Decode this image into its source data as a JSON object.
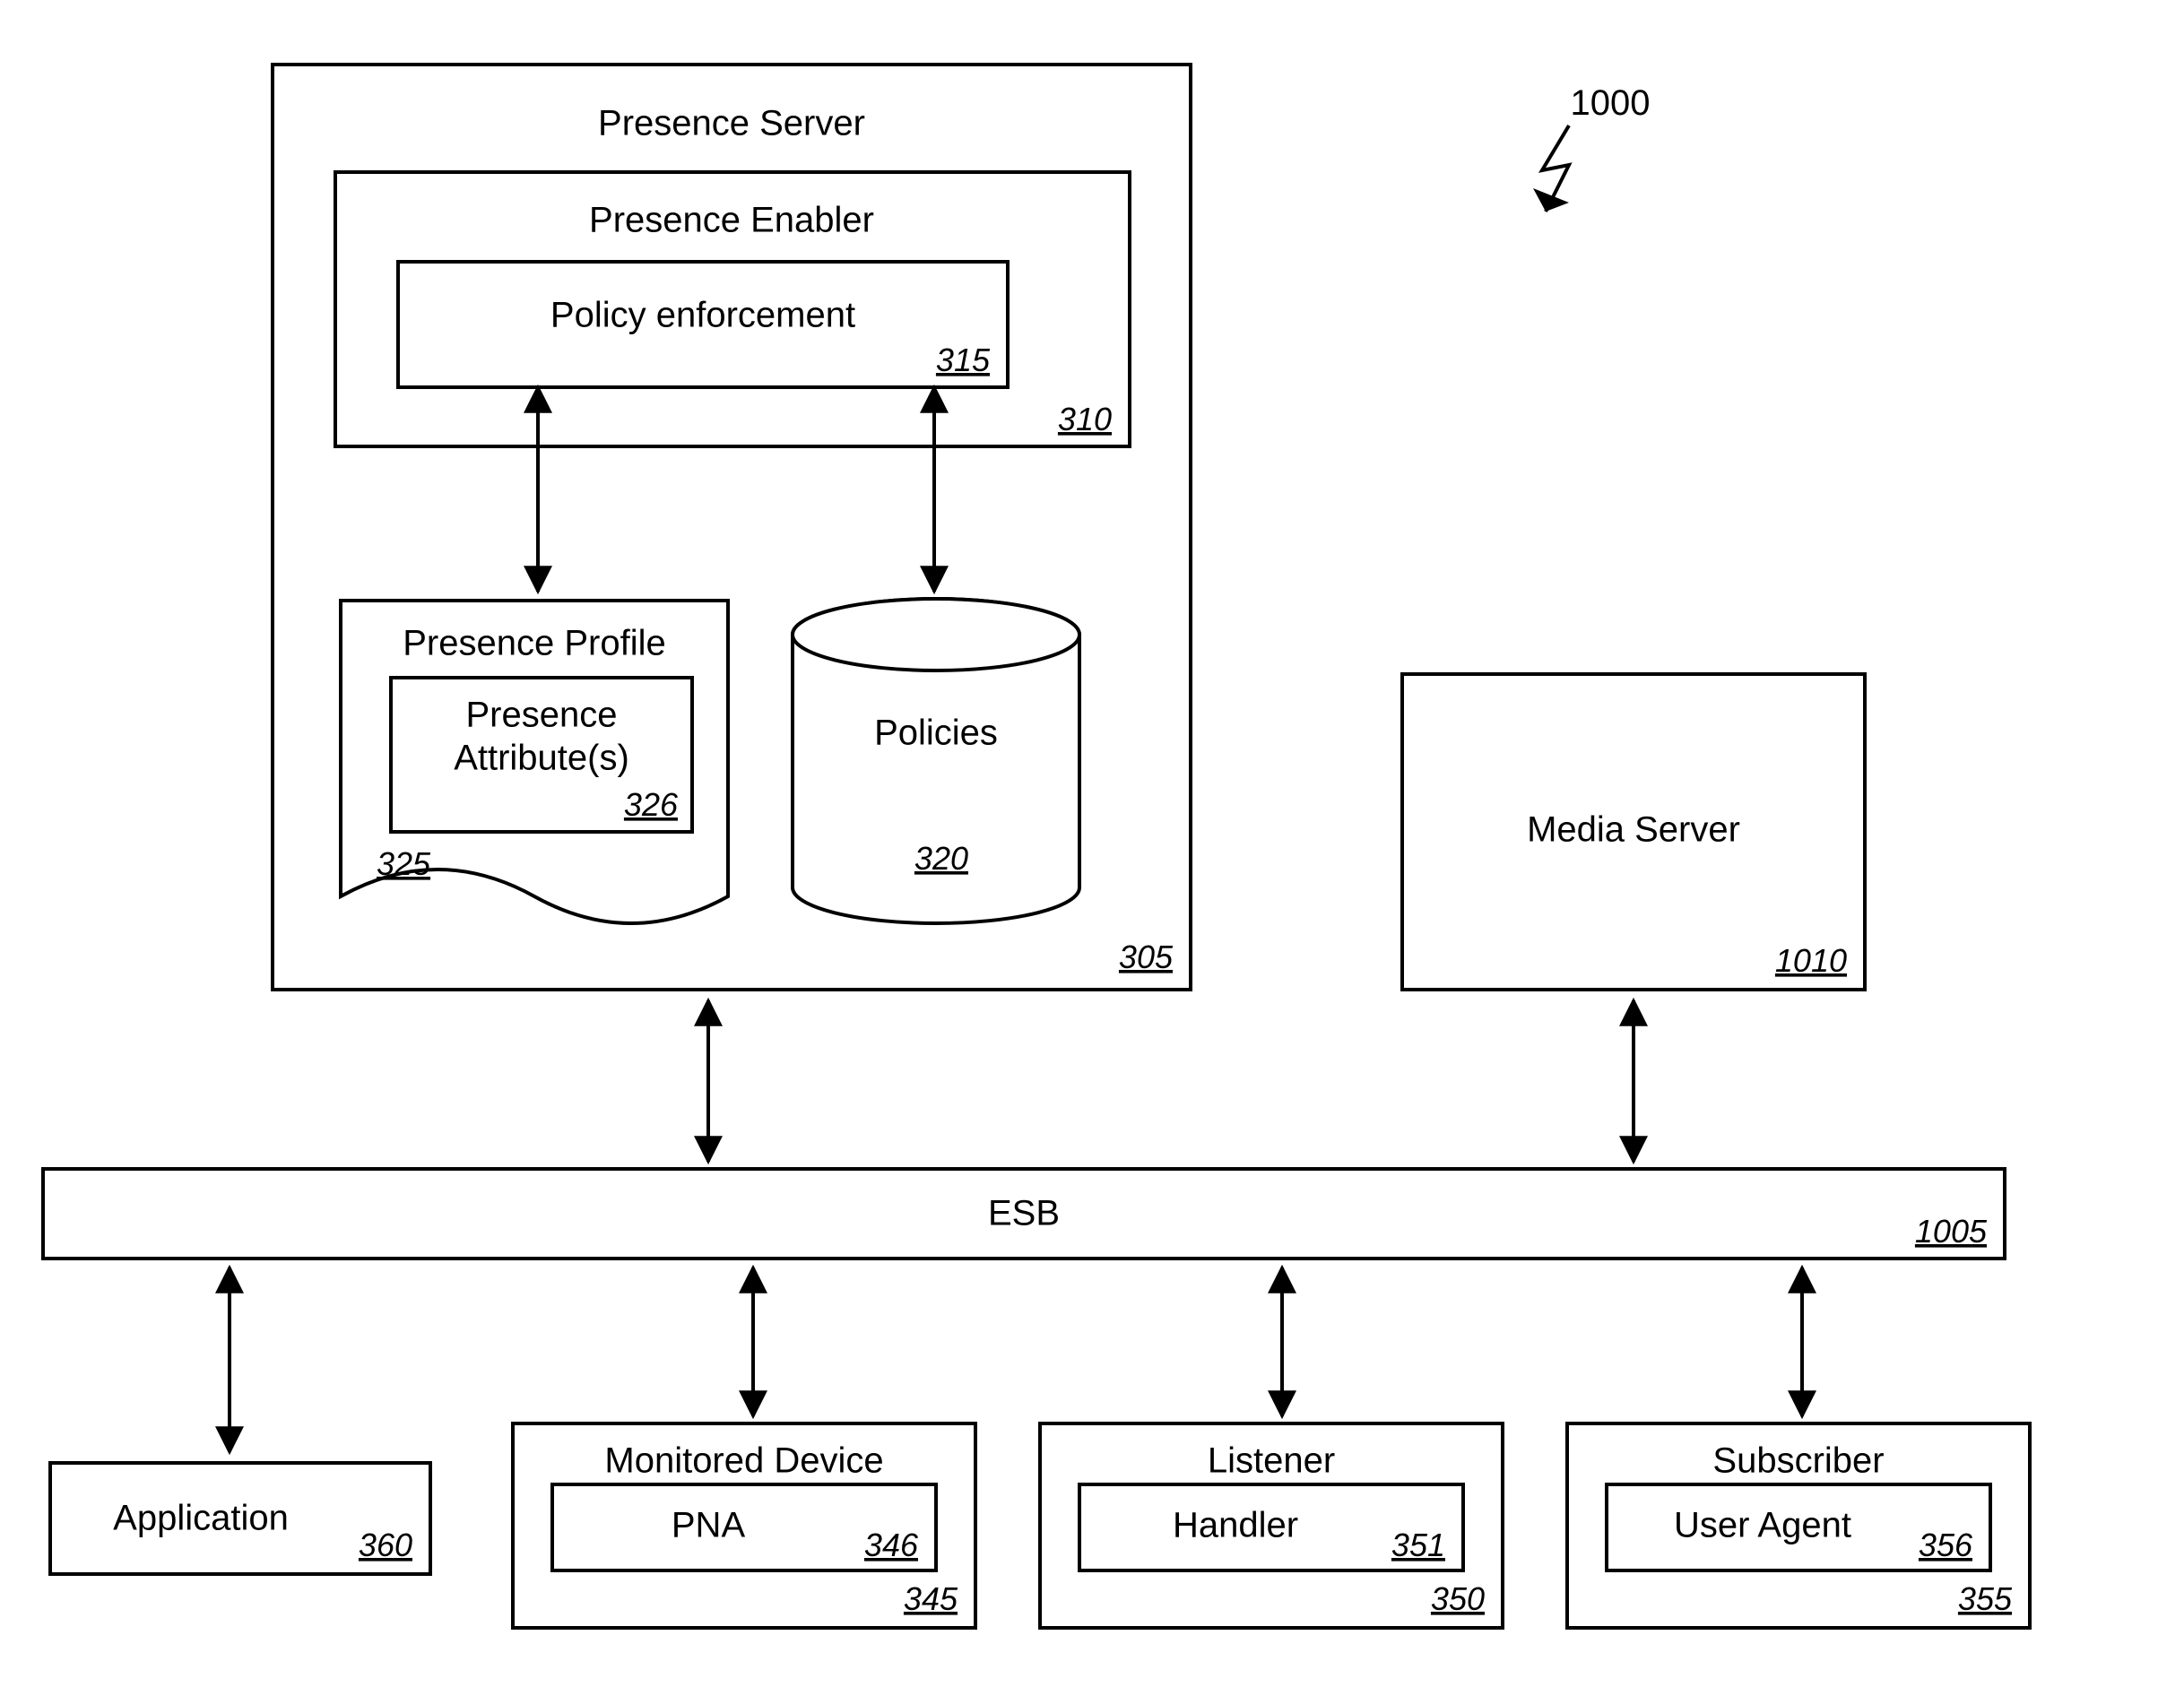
{
  "diagram": {
    "figure_ref": "1000",
    "presence_server": {
      "title": "Presence Server",
      "ref": "305"
    },
    "presence_enabler": {
      "title": "Presence Enabler",
      "ref": "310"
    },
    "policy_enforcement": {
      "title": "Policy enforcement",
      "ref": "315"
    },
    "presence_profile": {
      "title": "Presence Profile",
      "ref": "325"
    },
    "presence_attributes": {
      "title_line1": "Presence",
      "title_line2": "Attribute(s)",
      "ref": "326"
    },
    "policies": {
      "title": "Policies",
      "ref": "320"
    },
    "media_server": {
      "title": "Media Server",
      "ref": "1010"
    },
    "esb": {
      "title": "ESB",
      "ref": "1005"
    },
    "application": {
      "title": "Application",
      "ref": "360"
    },
    "monitored_device": {
      "title": "Monitored Device",
      "ref": "345"
    },
    "pna": {
      "title": "PNA",
      "ref": "346"
    },
    "listener": {
      "title": "Listener",
      "ref": "350"
    },
    "handler": {
      "title": "Handler",
      "ref": "351"
    },
    "subscriber": {
      "title": "Subscriber",
      "ref": "355"
    },
    "user_agent": {
      "title": "User Agent",
      "ref": "356"
    }
  }
}
